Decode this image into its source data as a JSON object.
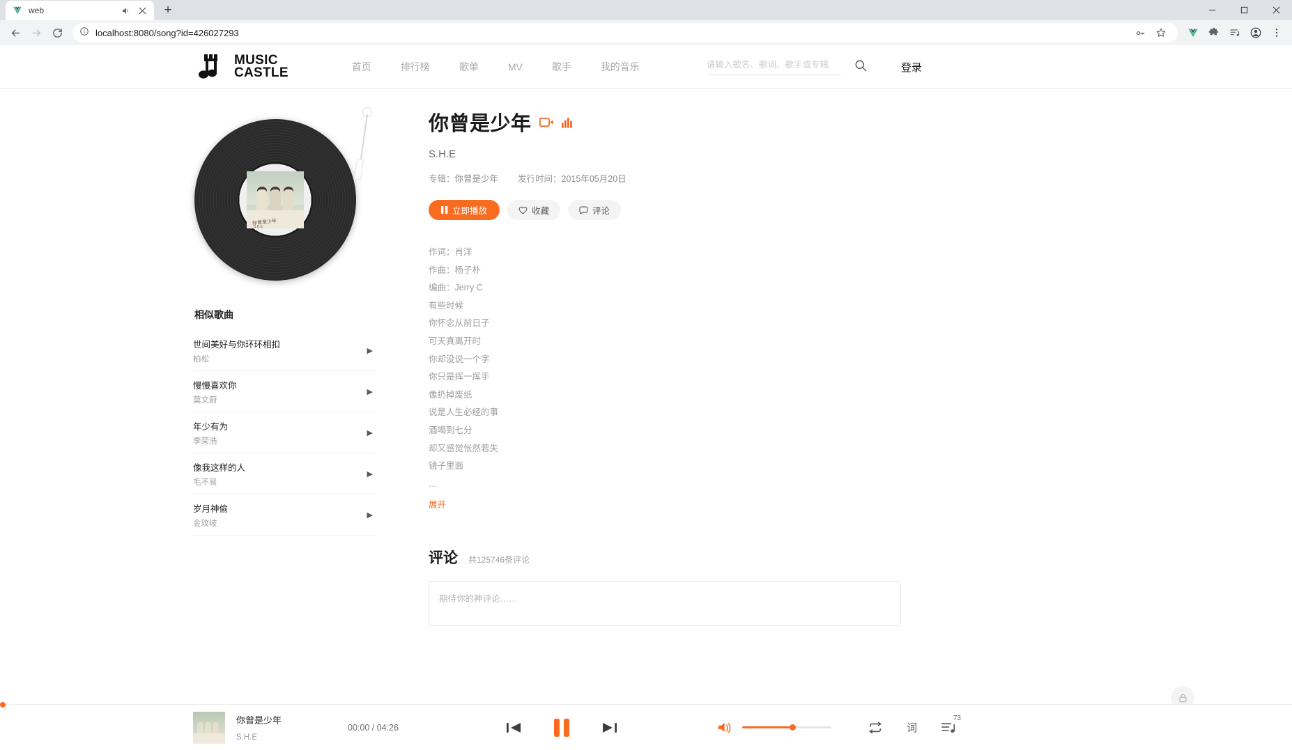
{
  "browser": {
    "tab_title": "web",
    "tab_favicon": "vue-logo-icon",
    "url": "localhost:8080/song?id=426027293",
    "new_tab_label": "+",
    "toolbar_icons": [
      "back-icon",
      "forward-icon",
      "reload-icon"
    ],
    "omnibox_icons": [
      "site-info-icon",
      "password-key-icon",
      "bookmark-star-icon"
    ],
    "extension_icons": [
      "vue-devtools-icon",
      "extensions-puzzle-icon",
      "media-list-icon",
      "profile-icon",
      "menu-dots-icon"
    ],
    "window_controls": [
      "minimize",
      "maximize",
      "close"
    ]
  },
  "header": {
    "logo_line1": "MUSIC",
    "logo_line2": "CASTLE",
    "nav": [
      {
        "label": "首页"
      },
      {
        "label": "排行榜"
      },
      {
        "label": "歌单"
      },
      {
        "label": "MV"
      },
      {
        "label": "歌手"
      },
      {
        "label": "我的音乐"
      }
    ],
    "search_placeholder": "请输入歌名、歌词、歌手或专辑",
    "search_value": "",
    "login_label": "登录"
  },
  "similar": {
    "title": "相似歌曲",
    "items": [
      {
        "name": "世间美好与你环环相扣",
        "artist": "柏松"
      },
      {
        "name": "慢慢喜欢你",
        "artist": "莫文蔚"
      },
      {
        "name": "年少有为",
        "artist": "李荣浩"
      },
      {
        "name": "像我这样的人",
        "artist": "毛不易"
      },
      {
        "name": "岁月神偷",
        "artist": "金玟岐"
      }
    ]
  },
  "song": {
    "title": "你曾是少年",
    "artist": "S.H.E",
    "album_label": "专辑：",
    "album_value": "你曾是少年",
    "release_label": "发行时间：",
    "release_value": "2015年05月20日",
    "play_button": "立即播放",
    "favorite_button": "收藏",
    "comment_button": "评论",
    "lyrics": [
      "作词：肖洋",
      "作曲：杨子朴",
      "编曲：Jerry C",
      "有些时候",
      "你怀念从前日子",
      "可天真离开时",
      "你却没说一个字",
      "你只是挥一挥手",
      "像扔掉废纸",
      "说是人生必经的事",
      "酒喝到七分",
      "却又感觉怅然若失",
      "镜子里面",
      "…"
    ],
    "expand_label": "展开"
  },
  "comments": {
    "title": "评论",
    "count_text": "共125746条评论",
    "input_placeholder": "期待你的神评论……"
  },
  "player": {
    "song_name": "你曾是少年",
    "artist": "S.H.E",
    "current_time": "00:00",
    "total_time": "04:26",
    "time_text": "00:00 / 04:26",
    "playlist_badge": "73",
    "controls": [
      "prev-icon",
      "pause-icon",
      "next-icon"
    ],
    "right_icons": [
      "volume-icon",
      "repeat-icon",
      "lyrics-icon",
      "playlist-icon"
    ],
    "lyrics_icon_label": "词"
  },
  "colors": {
    "accent": "#f96b1f",
    "accent_icon": "#f26522",
    "text_primary": "#1b1b1b",
    "text_muted": "#9d9da2"
  }
}
